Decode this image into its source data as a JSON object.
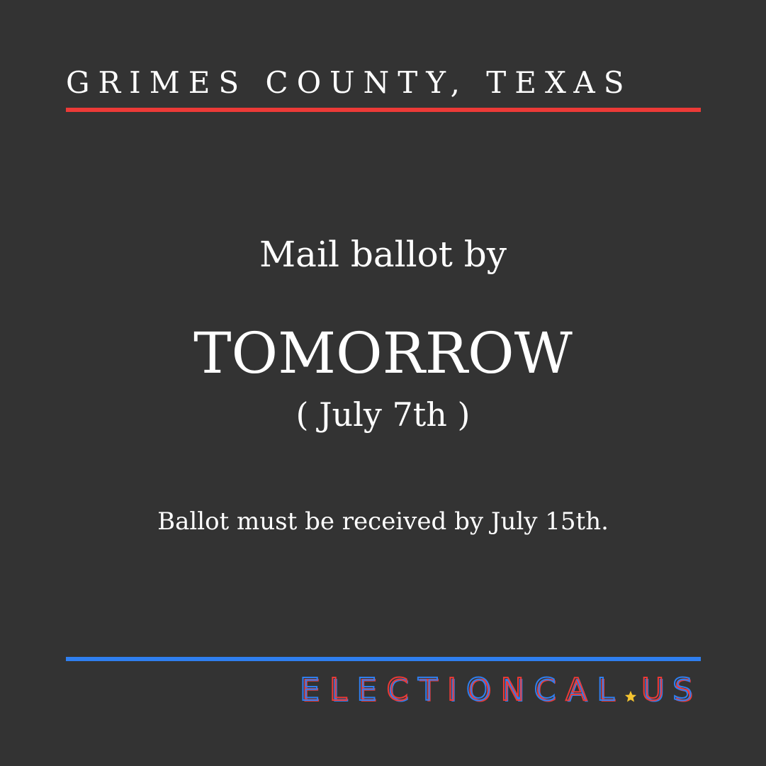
{
  "header": {
    "region": "GRIMES COUNTY, TEXAS"
  },
  "main": {
    "headline": "Mail ballot by",
    "deadline": "TOMORROW",
    "date": "( July 7th )",
    "note": "Ballot must be received by July 15th."
  },
  "footer": {
    "logo_part1": "ELECTIONCAL",
    "logo_part2": "US",
    "logo_icon": "star-icon"
  },
  "colors": {
    "background": "#333333",
    "accent_red": "#ec3a37",
    "accent_blue": "#2f7ff0",
    "star_yellow": "#f4c430",
    "text": "#ffffff"
  }
}
